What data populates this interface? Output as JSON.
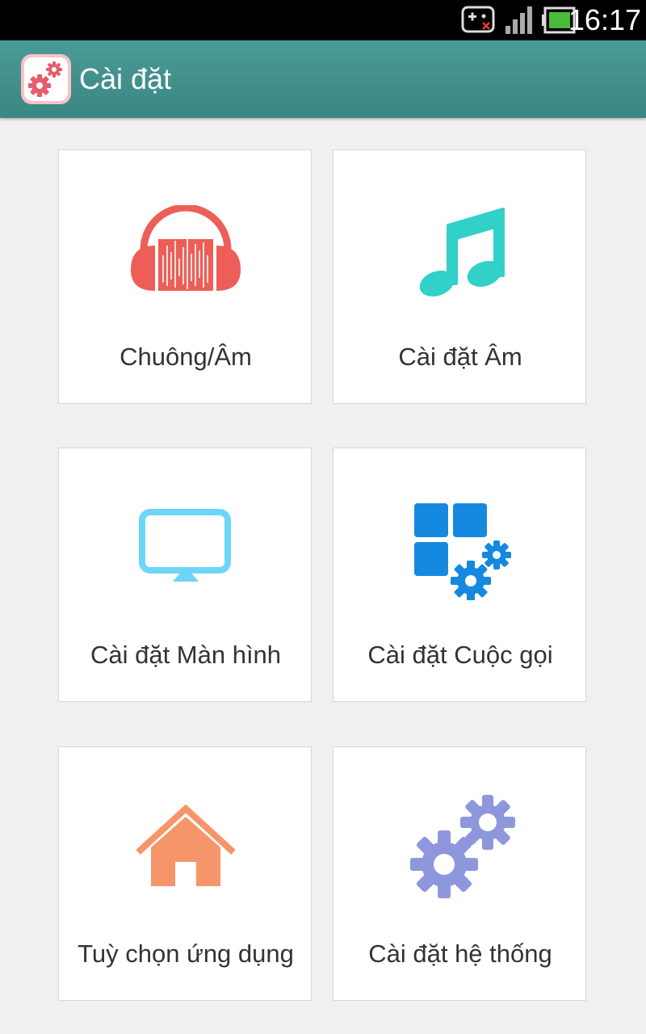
{
  "status_bar": {
    "time": "16:17",
    "icons": [
      "game-controller-icon",
      "signal-icon",
      "battery-icon"
    ]
  },
  "action_bar": {
    "title": "Cài đặt",
    "icon": "settings-app-icon"
  },
  "tiles": [
    {
      "label": "Chuông/Âm",
      "icon": "headphones-icon",
      "color": "#ec5e57"
    },
    {
      "label": "Cài đặt Âm",
      "icon": "music-note-icon",
      "color": "#31d0c8"
    },
    {
      "label": "Cài đặt Màn hình",
      "icon": "monitor-icon",
      "color": "#6dd6f8"
    },
    {
      "label": "Cài đặt Cuộc gọi",
      "icon": "apps-gear-icon",
      "color": "#1589e0"
    },
    {
      "label": "Tuỳ chọn ứng dụng",
      "icon": "home-icon",
      "color": "#f6956a"
    },
    {
      "label": "Cài đặt hệ thống",
      "icon": "gears-icon",
      "color": "#8e97dc"
    }
  ]
}
